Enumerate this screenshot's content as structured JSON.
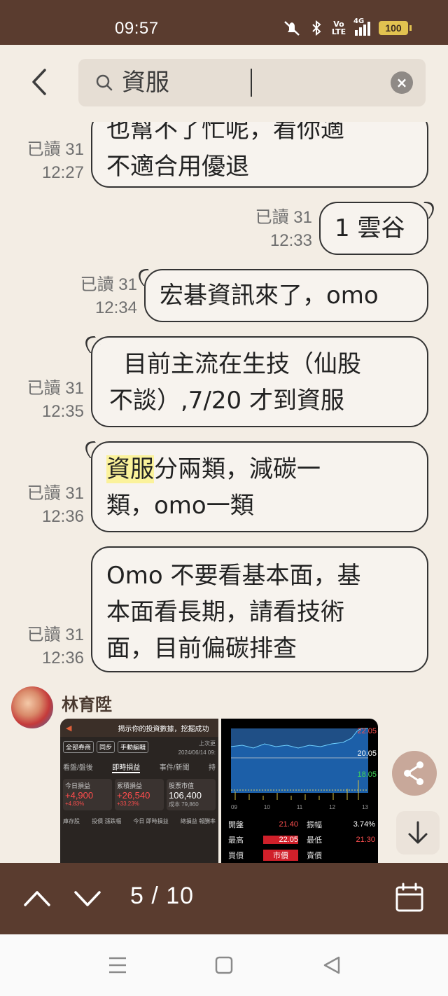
{
  "status_bar": {
    "time": "09:57",
    "network_label": "4G",
    "volte_label": "Vo LTE",
    "battery": "100"
  },
  "search": {
    "query": "資服",
    "clear_icon": "close-icon"
  },
  "messages": [
    {
      "side": "left",
      "read": "已讀 31",
      "time": "12:27",
      "lines": [
        "也幫不了忙呢，看你適",
        "不適合用優退"
      ]
    },
    {
      "side": "right",
      "read": "已讀 31",
      "time": "12:33",
      "lines": [
        "1 雲谷"
      ]
    },
    {
      "side": "left",
      "read": "已讀 31",
      "time": "12:34",
      "lines": [
        "宏碁資訊來了，omo"
      ]
    },
    {
      "side": "left",
      "read": "已讀 31",
      "time": "12:35",
      "lines": [
        "目前主流在生技（仙股",
        "不談）,7/20 才到資服"
      ]
    },
    {
      "side": "left",
      "read": "已讀 31",
      "time": "12:36",
      "highlight": "資服",
      "lines": [
        "分兩類，減碳一",
        "類，omo一類"
      ]
    },
    {
      "side": "left",
      "read": "已讀 31",
      "time": "12:36",
      "lines": [
        "Omo 不要看基本面，基",
        "本面看長期，請看技術",
        "面，目前偏碳排查"
      ]
    }
  ],
  "sender": {
    "name": "林育陞"
  },
  "thumb1": {
    "banner": "揭示你的投資數據，挖掘成功",
    "btn_all": "全部券商",
    "btn_sync": "同步",
    "btn_edit": "手動編輯",
    "date": "2024/06/14 09:",
    "update": "上次更",
    "tabs": [
      "看盤/盤後",
      "即時損益",
      "事件/新聞",
      "持"
    ],
    "cards": [
      {
        "label": "今日損益",
        "value": "+4,900",
        "pct": "+4.83%"
      },
      {
        "label": "累積損益",
        "value": "+26,540",
        "pct": "+33.23%"
      },
      {
        "label": "股票市值",
        "value": "106,400",
        "pct": "成本 79,860"
      }
    ],
    "footer": [
      "庫存股",
      "投債 漲跌幅",
      "今日 即時損益",
      "總損益 報酬率"
    ]
  },
  "thumb2": {
    "prices": [
      "22.05",
      "20.05",
      "18.05"
    ],
    "axis": [
      "09",
      "10",
      "11",
      "12",
      "13"
    ],
    "rows": [
      {
        "k1": "開盤",
        "v1": "21.40",
        "k2": "振幅",
        "v2": "3.74%"
      },
      {
        "k1": "最高",
        "v1": "22.05",
        "k2": "最低",
        "v2": "21.30"
      },
      {
        "k1": "買價",
        "v1": "市價",
        "k2": "賣價",
        "v2": ""
      }
    ]
  },
  "pager": {
    "text": "5 / 10"
  },
  "colors": {
    "brand": "#5a3c2f",
    "background": "#f3ede4",
    "highlight": "#fbf29b",
    "share_fab": "#c8a89a"
  }
}
